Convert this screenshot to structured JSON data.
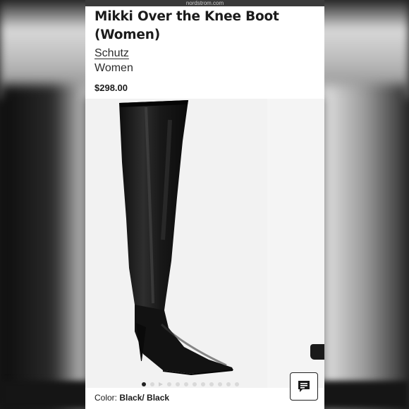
{
  "browser": {
    "url_fragment": "nordstrom.com"
  },
  "product": {
    "title": "Mikki Over the Knee Boot (Women)",
    "brand": "Schutz",
    "department": "Women",
    "price": "$298.00",
    "color_label": "Color:",
    "color_value": "Black/ Black"
  },
  "gallery": {
    "image_count": 12,
    "active_index": 0,
    "video_indicator_index": 2
  },
  "chat": {
    "icon": "chat-bubble-icon"
  },
  "colors": {
    "text": "#1b1b1b",
    "image_background": "#f2f2f2",
    "boot": "#161616"
  }
}
